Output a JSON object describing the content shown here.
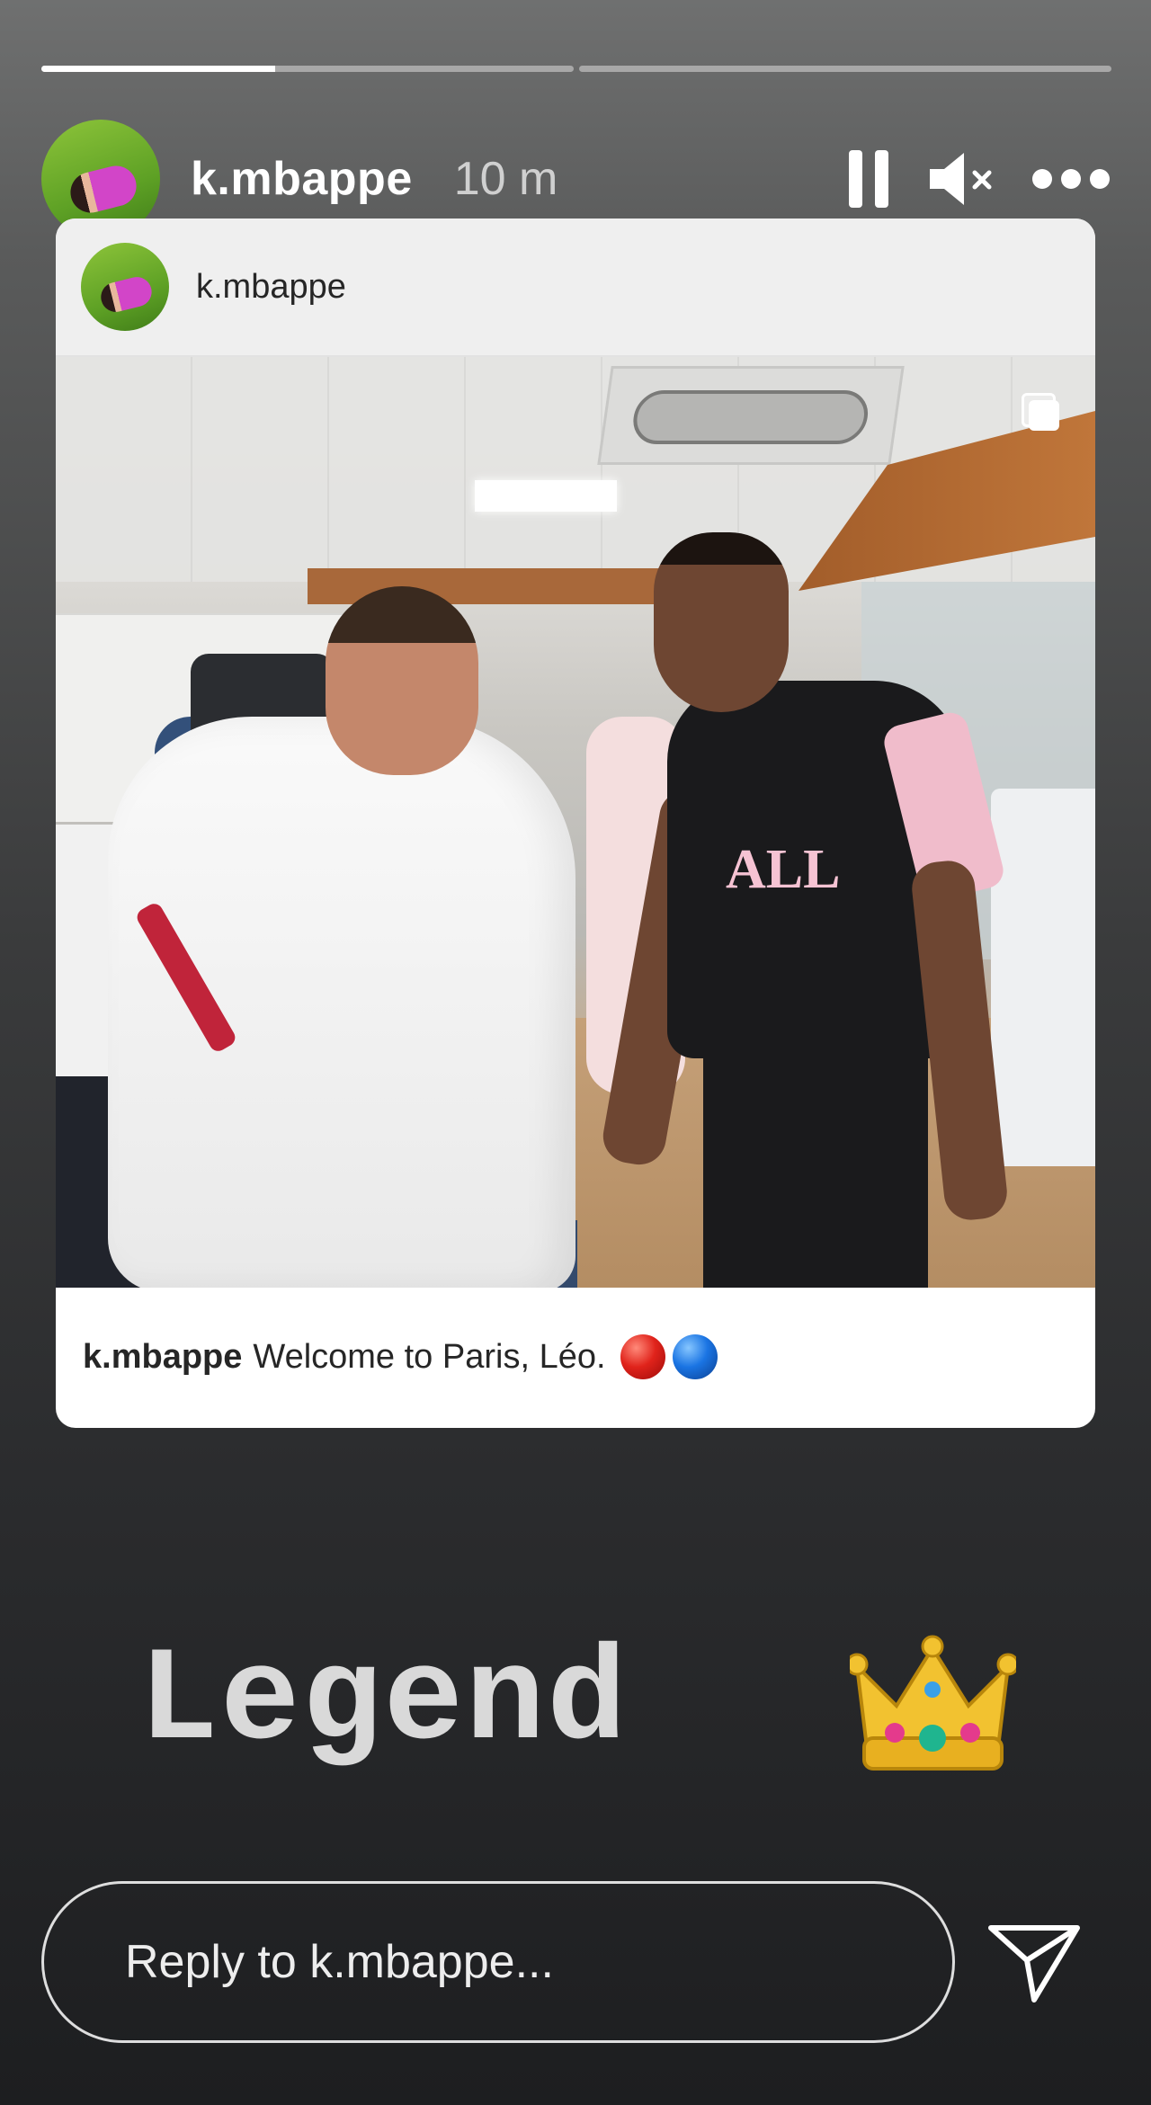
{
  "story": {
    "segments": [
      {
        "progress": 0.44
      },
      {
        "progress": 0.0
      }
    ],
    "username": "k.mbappe",
    "time_ago": "10 m",
    "avatar_icon": "profile-avatar"
  },
  "header_actions": {
    "pause_icon": "pause-icon",
    "mute_icon": "volume-muted-icon",
    "more_icon": "more-horizontal-icon"
  },
  "shared_post": {
    "username": "k.mbappe",
    "multi_icon": "carousel-icon",
    "caption_user": "k.mbappe",
    "caption_text": "Welcome to Paris, Léo.",
    "caption_emojis": [
      "red-circle",
      "blue-circle"
    ],
    "jersey_text": "ALL"
  },
  "sticker": {
    "text": "Legend",
    "emoji": "crown-emoji"
  },
  "reply": {
    "placeholder": "Reply to k.mbappe...",
    "send_icon": "send-icon"
  }
}
